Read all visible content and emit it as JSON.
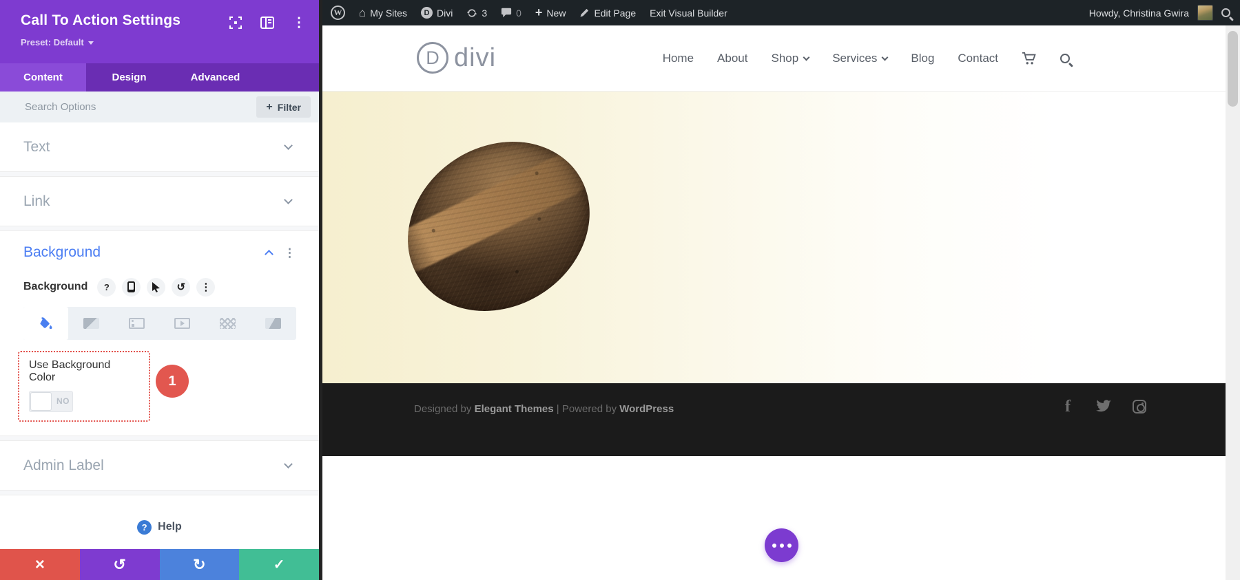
{
  "panel": {
    "title": "Call To Action Settings",
    "preset_label": "Preset: Default",
    "tabs": [
      {
        "label": "Content"
      },
      {
        "label": "Design"
      },
      {
        "label": "Advanced"
      }
    ],
    "search": {
      "placeholder": "Search Options",
      "filter_label": "Filter"
    },
    "accordions": {
      "text": "Text",
      "link": "Link",
      "admin_label": "Admin Label"
    },
    "background": {
      "section_title": "Background",
      "field_label": "Background",
      "use_bg_label": "Use Background Color",
      "toggle_value": "NO",
      "annotation_badge": "1"
    },
    "help_label": "Help"
  },
  "admin_bar": {
    "my_sites": "My Sites",
    "divi": "Divi",
    "updates_count": "3",
    "comments_count": "0",
    "new_label": "New",
    "edit_page": "Edit Page",
    "exit_builder": "Exit Visual Builder",
    "howdy": "Howdy, Christina Gwira"
  },
  "site": {
    "logo_letter": "D",
    "logo_text": "divi",
    "nav": [
      "Home",
      "About",
      "Shop",
      "Services",
      "Blog",
      "Contact"
    ],
    "footer": {
      "designed_by": "Designed by",
      "elegant_themes": "Elegant Themes",
      "separator": "|",
      "powered_by": "Powered by",
      "wordpress": "WordPress"
    }
  },
  "icons": {
    "kebab": "⋮",
    "question": "?",
    "plus": "+",
    "close": "×",
    "undo": "↺",
    "redo": "↻",
    "check": "✓",
    "house": "⌂",
    "wp_letter": "W",
    "divi_letter": "D",
    "facebook_letter": "f"
  },
  "colors": {
    "builder_purple": "#7E3BD0",
    "section_blue": "#4C7EF3",
    "cancel_red": "#E0544B",
    "redo_blue": "#4C82DC",
    "save_green": "#41BE95",
    "admin_bar_dark": "#1D2327",
    "footer_dark": "#1B1B1B",
    "annotation_red": "#E2574F"
  }
}
